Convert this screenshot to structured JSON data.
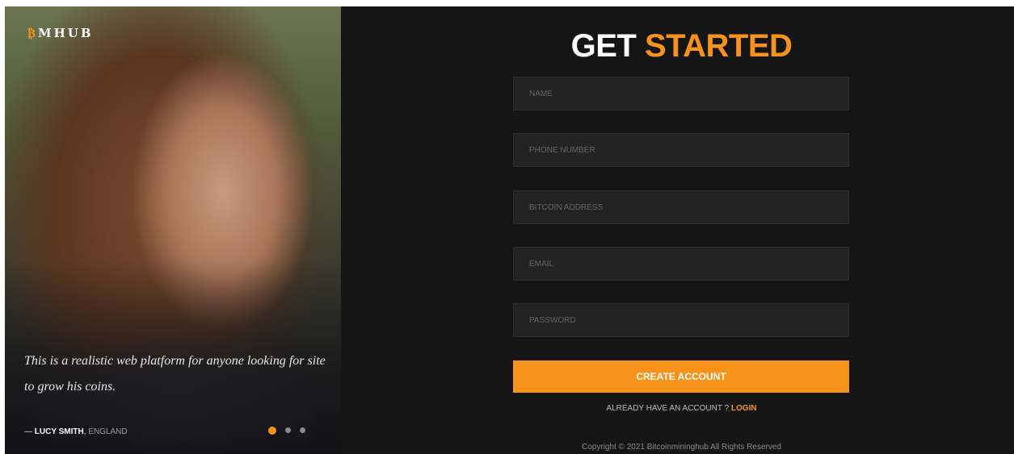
{
  "brand": {
    "prefix": "₿",
    "name": "MHUB",
    "accent_color": "#f7931a"
  },
  "testimonial": {
    "quote": "This is a realistic web platform for anyone looking for site to grow his coins.",
    "dash": "— ",
    "author": "LUCY SMITH",
    "separator": ",",
    "location": " ENGLAND",
    "slides": {
      "count": 3,
      "active": 1
    }
  },
  "form": {
    "title_white": "GET",
    "title_orange": "STARTED",
    "fields": [
      {
        "placeholder": "NAME",
        "value": ""
      },
      {
        "placeholder": "PHONE NUMBER",
        "value": ""
      },
      {
        "placeholder": "BITCOIN ADDRESS",
        "value": ""
      },
      {
        "placeholder": "EMAIL",
        "value": ""
      },
      {
        "placeholder": "PASSWORD",
        "value": ""
      }
    ],
    "submit_label": "CREATE ACCOUNT",
    "already_text": "ALREADY HAVE AN ACCOUNT ? ",
    "login_label": "LOGIN"
  },
  "footer": {
    "copyright": "Copyright © 2021 Bitcoinmininghub All Rights Reserved"
  }
}
